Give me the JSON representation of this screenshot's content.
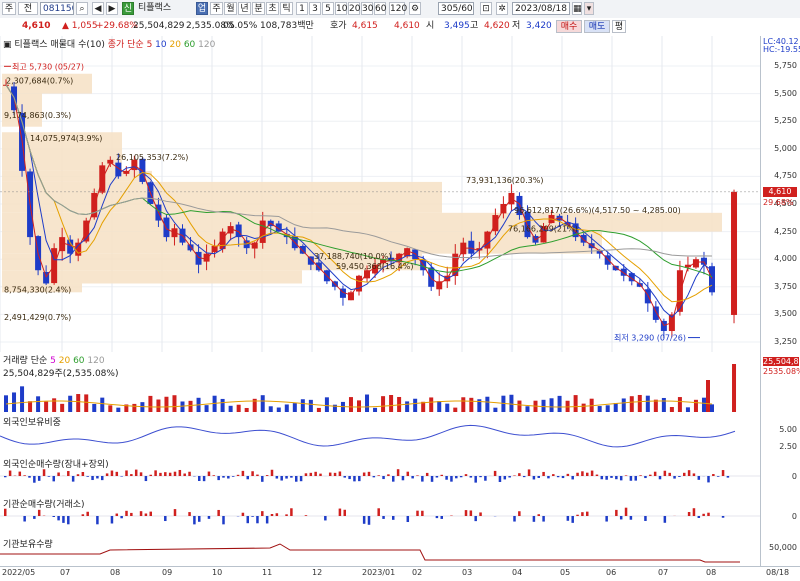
{
  "toolbar": {
    "menu_label": "주",
    "menu2_label": "전",
    "code": "081150",
    "search_label": "Q",
    "sin_label": "신",
    "name": "티플랙스",
    "chart_btn": "업",
    "periods": [
      "주",
      "월",
      "년",
      "분",
      "초",
      "틱"
    ],
    "minutes": [
      "1",
      "3",
      "5",
      "10",
      "20",
      "30",
      "60",
      "120"
    ],
    "count": "305/600",
    "date": "2023/08/18",
    "buy": "매수",
    "sell": "매도",
    "eval": "평"
  },
  "quote": {
    "price": "4,610",
    "change": "▲ 1,055",
    "rate": "+29.68%",
    "volume": "25,504,829",
    "turnover": "2,535.08%",
    "ratio": "05.05%",
    "amount": "108,783백만",
    "bid_label": "호가",
    "bid": "4,615",
    "ask": "4,610",
    "open_label": "시",
    "open": "3,495",
    "high_label": "고",
    "high": "4,620",
    "low_label": "저",
    "low": "3,420"
  },
  "price_pane": {
    "title": "티플랙스 매물대 수(10)",
    "ma_label": "종가 단순",
    "ma_periods": [
      "5",
      "10",
      "20",
      "60",
      "120"
    ],
    "ma_colors": [
      "#d0201e",
      "#1e3cc8",
      "#e5a000",
      "#2e9e2e",
      "#9a9a9a"
    ],
    "right_labels": [
      "LC:40.12",
      "HC:-19.55"
    ],
    "price_tag": "4,610",
    "pct_tag": "29.68%",
    "annotations": {
      "high": "최고 5,730 (05/27)",
      "low": "최저 3,290 (07/26)",
      "vp": [
        "2,307,684(0.7%)",
        "9,174,863(0.3%)",
        "14,075,974(3.9%)",
        "26,105,353(7.2%)",
        "73,931,136(20.3%)",
        "96,612,817(26.6%)(4,517.50 ~ 4,285.00)",
        "76,166,209(21%)",
        "37,188,740(10.0%)",
        "59,450,368(16.4%)",
        "8,754,330(2.4%)",
        "2,491,429(0.7%)"
      ]
    }
  },
  "volume_pane": {
    "title": "거래량 단순",
    "ma_periods": [
      "5",
      "20",
      "60",
      "120"
    ],
    "ma_colors": [
      "#d000d0",
      "#e5a000",
      "#2e9e2e",
      "#9a9a9a"
    ],
    "value": "25,504,829주(2,535.08%)",
    "tag1": "25,504,82",
    "tag2": "2535.08%"
  },
  "foreign_ratio_pane": {
    "title": "외국인보유비중",
    "ticks": [
      "5.00",
      "2.50"
    ]
  },
  "foreign_net_pane": {
    "title": "외국인순매수량(장내+장외)",
    "ticks": [
      "0"
    ]
  },
  "inst_net_pane": {
    "title": "기관순매수량(거래소)",
    "ticks": [
      "0"
    ]
  },
  "inst_hold_pane": {
    "title": "기관보유수량",
    "ticks": [
      "50,000"
    ]
  },
  "x_axis": {
    "labels": [
      "2022/05",
      "07",
      "08",
      "09",
      "10",
      "11",
      "12",
      "2023/01",
      "02",
      "03",
      "04",
      "05",
      "06",
      "07",
      "08",
      "08/18"
    ]
  },
  "chart_data": {
    "type": "candlestick",
    "title": "티플랙스",
    "x_start": "2022/05",
    "x_end": "08/18",
    "ylim": [
      3250,
      5750
    ],
    "y_ticks": [
      5750,
      5500,
      5250,
      5000,
      4750,
      4500,
      4250,
      4000,
      3750,
      3500,
      3250
    ],
    "close_series": [
      5580,
      5350,
      4800,
      4200,
      3900,
      3780,
      4100,
      4200,
      4050,
      4150,
      4350,
      4600,
      4850,
      4900,
      4750,
      4800,
      4900,
      4700,
      4500,
      4350,
      4200,
      4280,
      4150,
      4080,
      3950,
      4050,
      4120,
      4250,
      4300,
      4200,
      4100,
      4150,
      4350,
      4300,
      4250,
      4200,
      4100,
      4050,
      3950,
      3900,
      3800,
      3750,
      3650,
      3700,
      3850,
      3900,
      3950,
      4000,
      3980,
      4050,
      4100,
      4000,
      3900,
      3750,
      3800,
      3850,
      4050,
      4150,
      4050,
      4100,
      4250,
      4400,
      4500,
      4600,
      4400,
      4200,
      4150,
      4300,
      4400,
      4350,
      4300,
      4200,
      4150,
      4100,
      4050,
      3950,
      3900,
      3850,
      3800,
      3750,
      3600,
      3450,
      3350,
      3500,
      3900,
      3950,
      4000,
      3950,
      3700
    ],
    "last_close": 4610,
    "high": {
      "value": 5730,
      "date": "05/27"
    },
    "low": {
      "value": 3290,
      "date": "07/26"
    }
  }
}
